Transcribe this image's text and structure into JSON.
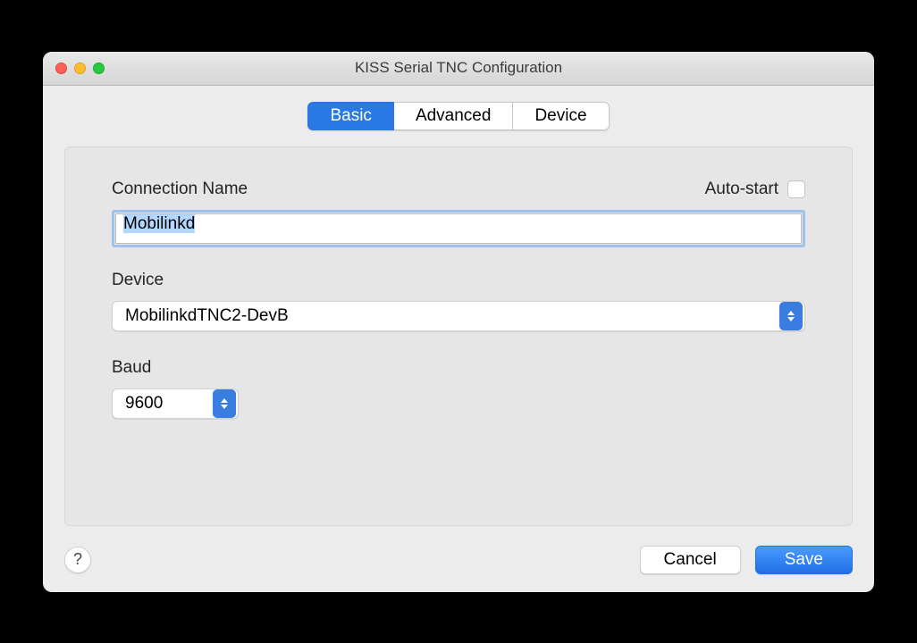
{
  "window": {
    "title": "KISS Serial TNC Configuration"
  },
  "tabs": {
    "basic": "Basic",
    "advanced": "Advanced",
    "device": "Device"
  },
  "form": {
    "connection_name_label": "Connection Name",
    "auto_start_label": "Auto-start",
    "connection_name_value": "Mobilinkd",
    "device_label": "Device",
    "device_value": "MobilinkdTNC2-DevB",
    "baud_label": "Baud",
    "baud_value": "9600"
  },
  "footer": {
    "help": "?",
    "cancel": "Cancel",
    "save": "Save"
  }
}
